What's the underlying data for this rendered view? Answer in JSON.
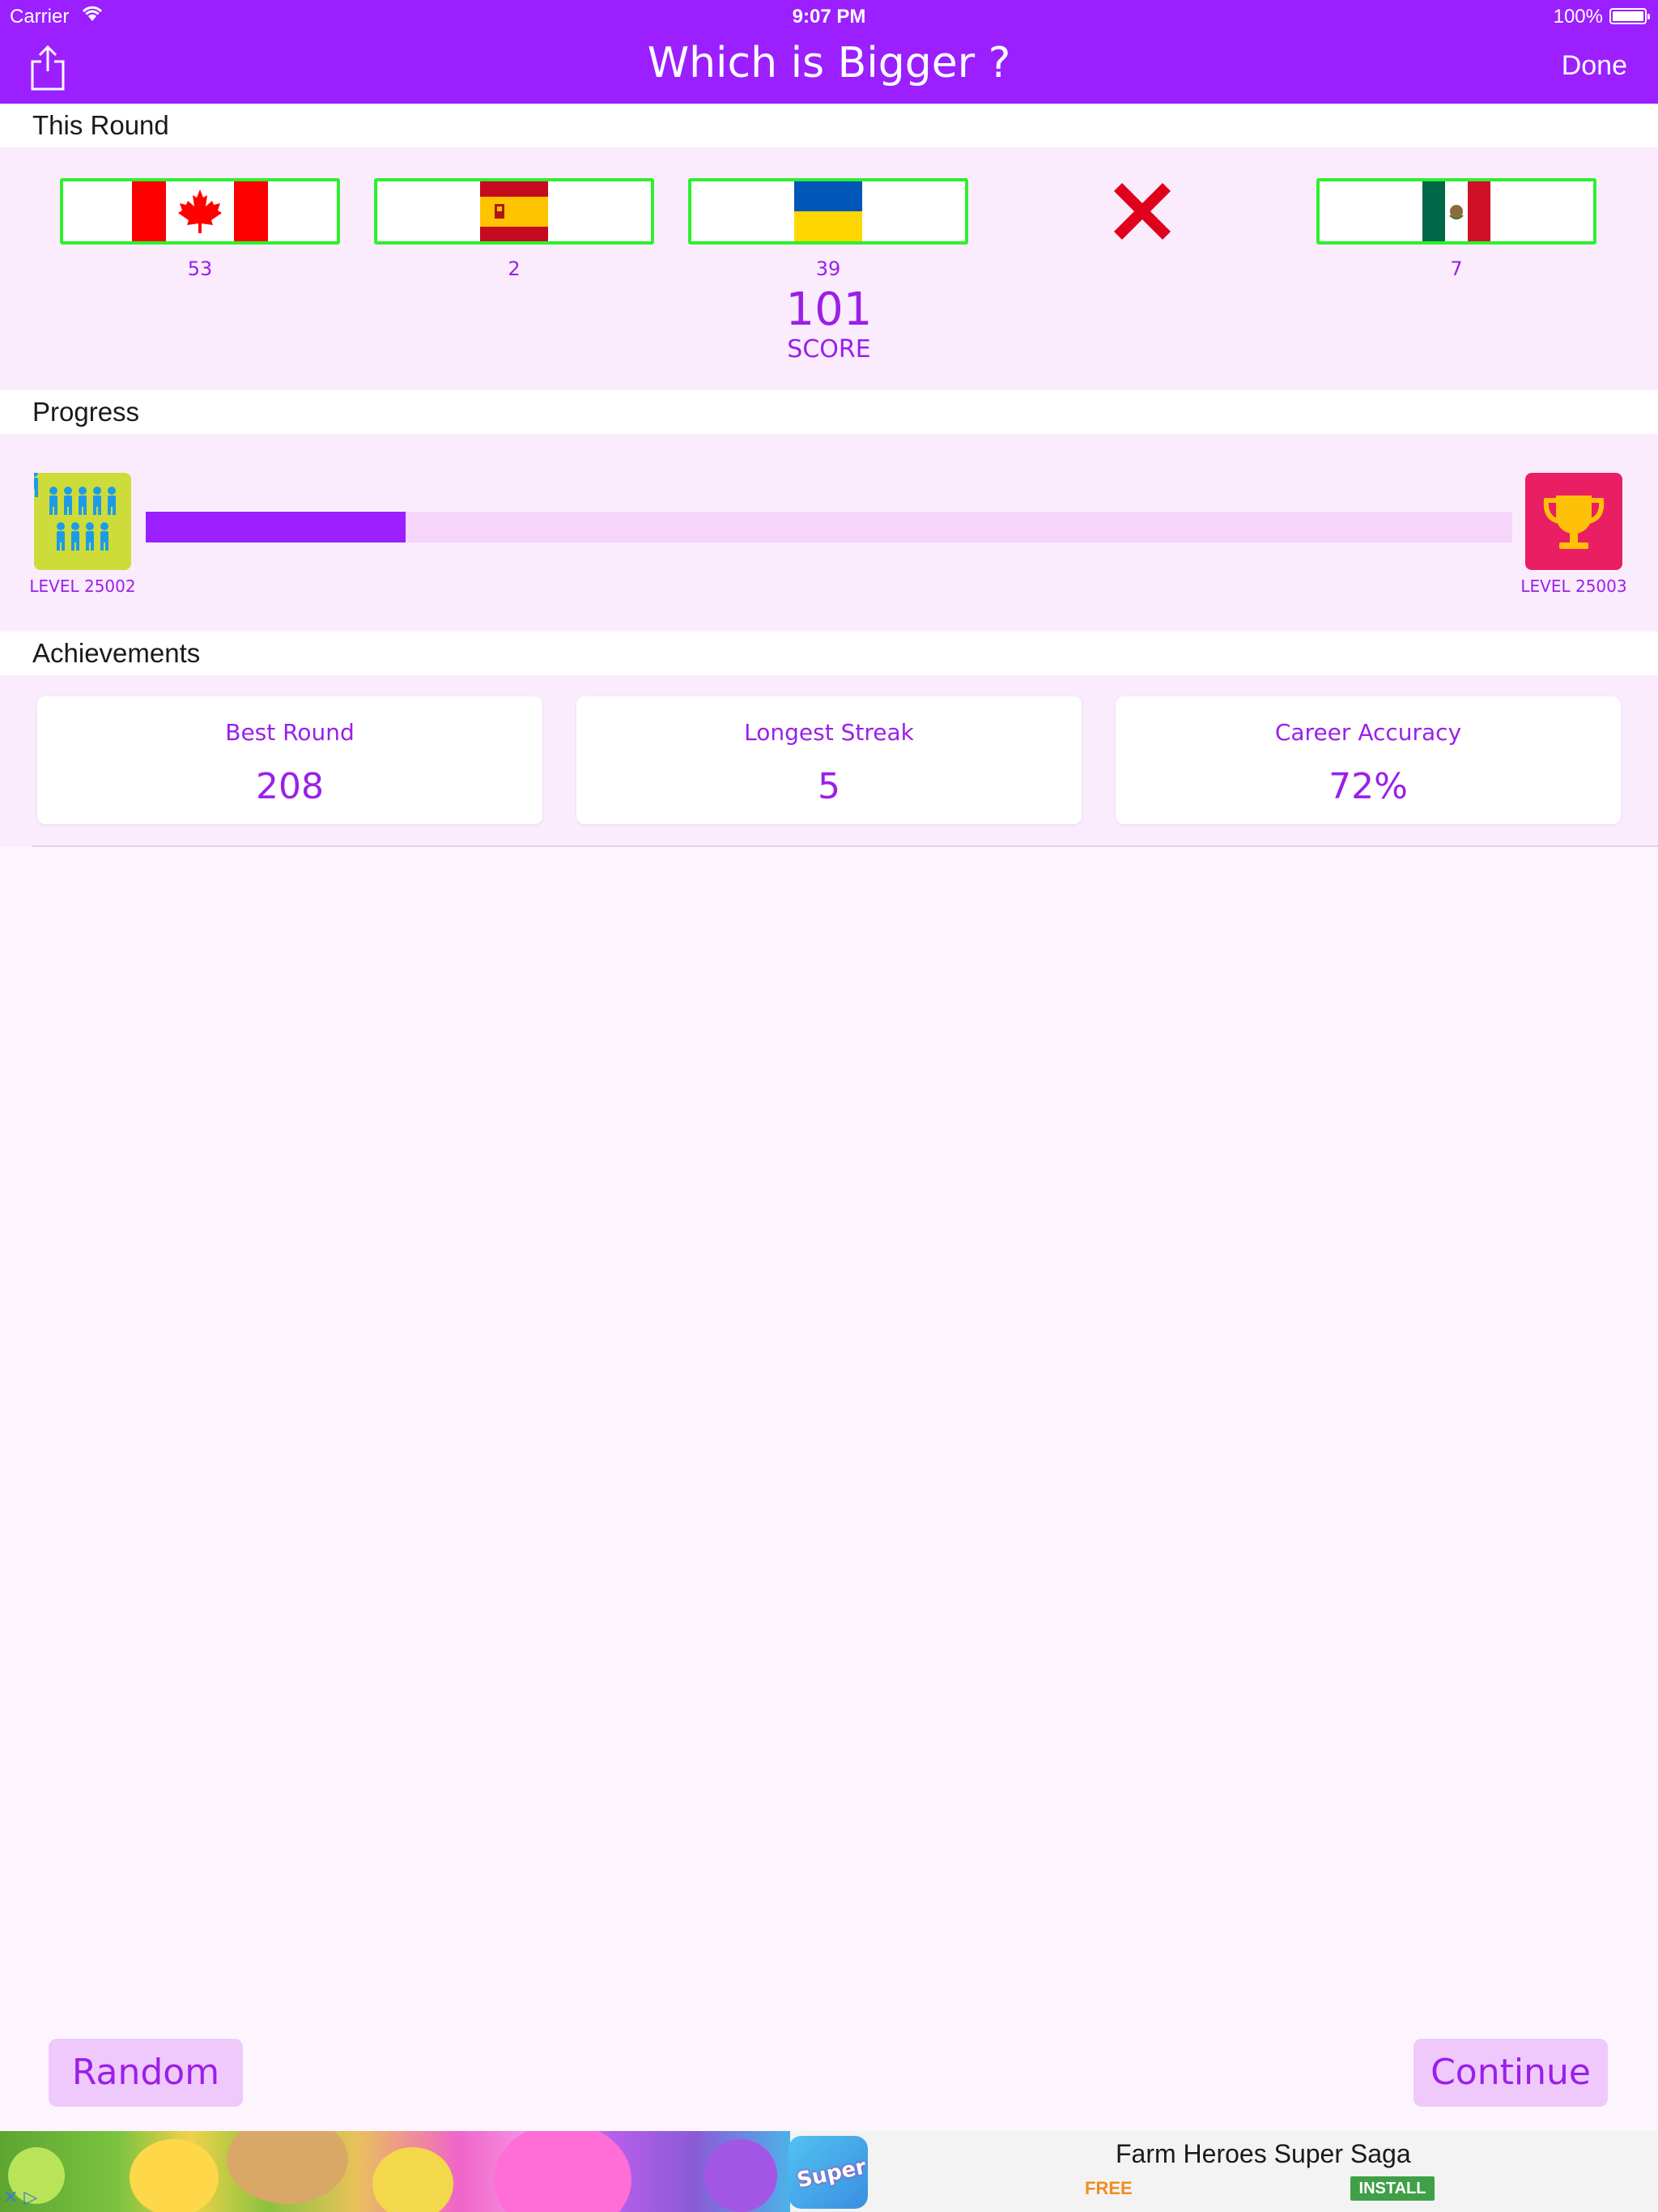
{
  "status_bar": {
    "carrier": "Carrier",
    "time": "9:07 PM",
    "battery": "100%"
  },
  "nav": {
    "title": "Which is Bigger ?",
    "done_label": "Done",
    "share_icon": "share-icon"
  },
  "this_round": {
    "header": "This Round",
    "flags": [
      {
        "country_icon": "canada-flag-icon",
        "value": "53",
        "result": "correct"
      },
      {
        "country_icon": "spain-flag-icon",
        "value": "2",
        "result": "correct"
      },
      {
        "country_icon": "ukraine-flag-icon",
        "value": "39",
        "result": "correct"
      },
      {
        "country_icon": "wrong-x-icon",
        "value": "",
        "result": "wrong"
      },
      {
        "country_icon": "mexico-flag-icon",
        "value": "7",
        "result": "correct"
      }
    ],
    "score_value": "101",
    "score_label": "SCORE"
  },
  "progress": {
    "header": "Progress",
    "current_level": "LEVEL 25002",
    "next_level": "LEVEL 25003",
    "fraction": 0.19,
    "current_icon": "people-icon",
    "next_icon": "trophy-icon"
  },
  "achievements": {
    "header": "Achievements",
    "cards": [
      {
        "label": "Best Round",
        "value": "208"
      },
      {
        "label": "Longest Streak",
        "value": "5"
      },
      {
        "label": "Career Accuracy",
        "value": "72%"
      }
    ]
  },
  "buttons": {
    "random": "Random",
    "continue": "Continue"
  },
  "ad": {
    "title": "Farm Heroes Super Saga",
    "price": "FREE",
    "install": "INSTALL",
    "icon_text": "Super"
  },
  "colors": {
    "accent": "#9b1fff",
    "correct_border": "#2ef02e",
    "wrong": "#e0001b",
    "level_current_bg": "#cddc39",
    "level_next_bg": "#e91e63"
  }
}
